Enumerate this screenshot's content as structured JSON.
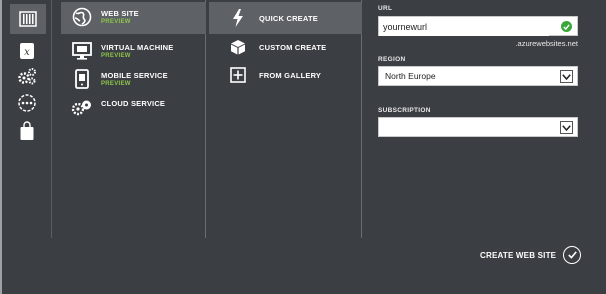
{
  "categories": [
    {
      "name": "compute-icon",
      "selected": true
    },
    {
      "name": "data-services-icon",
      "selected": false
    },
    {
      "name": "app-services-icon",
      "selected": false
    },
    {
      "name": "network-services-icon",
      "selected": false
    },
    {
      "name": "store-icon",
      "selected": false
    }
  ],
  "services": [
    {
      "label": "WEB SITE",
      "sub": "PREVIEW",
      "icon": "web-site-icon",
      "selected": true
    },
    {
      "label": "VIRTUAL MACHINE",
      "sub": "PREVIEW",
      "icon": "virtual-machine-icon",
      "selected": false
    },
    {
      "label": "MOBILE SERVICE",
      "sub": "PREVIEW",
      "icon": "mobile-service-icon",
      "selected": false
    },
    {
      "label": "CLOUD SERVICE",
      "sub": "",
      "icon": "cloud-service-icon",
      "selected": false
    }
  ],
  "options": [
    {
      "label": "QUICK CREATE",
      "icon": "lightning-icon",
      "selected": true
    },
    {
      "label": "CUSTOM CREATE",
      "icon": "cube-icon",
      "selected": false
    },
    {
      "label": "FROM GALLERY",
      "icon": "gallery-icon",
      "selected": false
    }
  ],
  "form": {
    "url_label": "URL",
    "url_value": "yournewurl",
    "url_suffix": ".azurewebsites.net",
    "region_label": "REGION",
    "region_value": "North Europe",
    "subscription_label": "SUBSCRIPTION",
    "subscription_value": ""
  },
  "create_label": "CREATE WEB SITE",
  "colors": {
    "background": "#3b3e43",
    "selected": "#5e6166",
    "preview": "#8fc54a",
    "valid": "#3aa73a"
  }
}
